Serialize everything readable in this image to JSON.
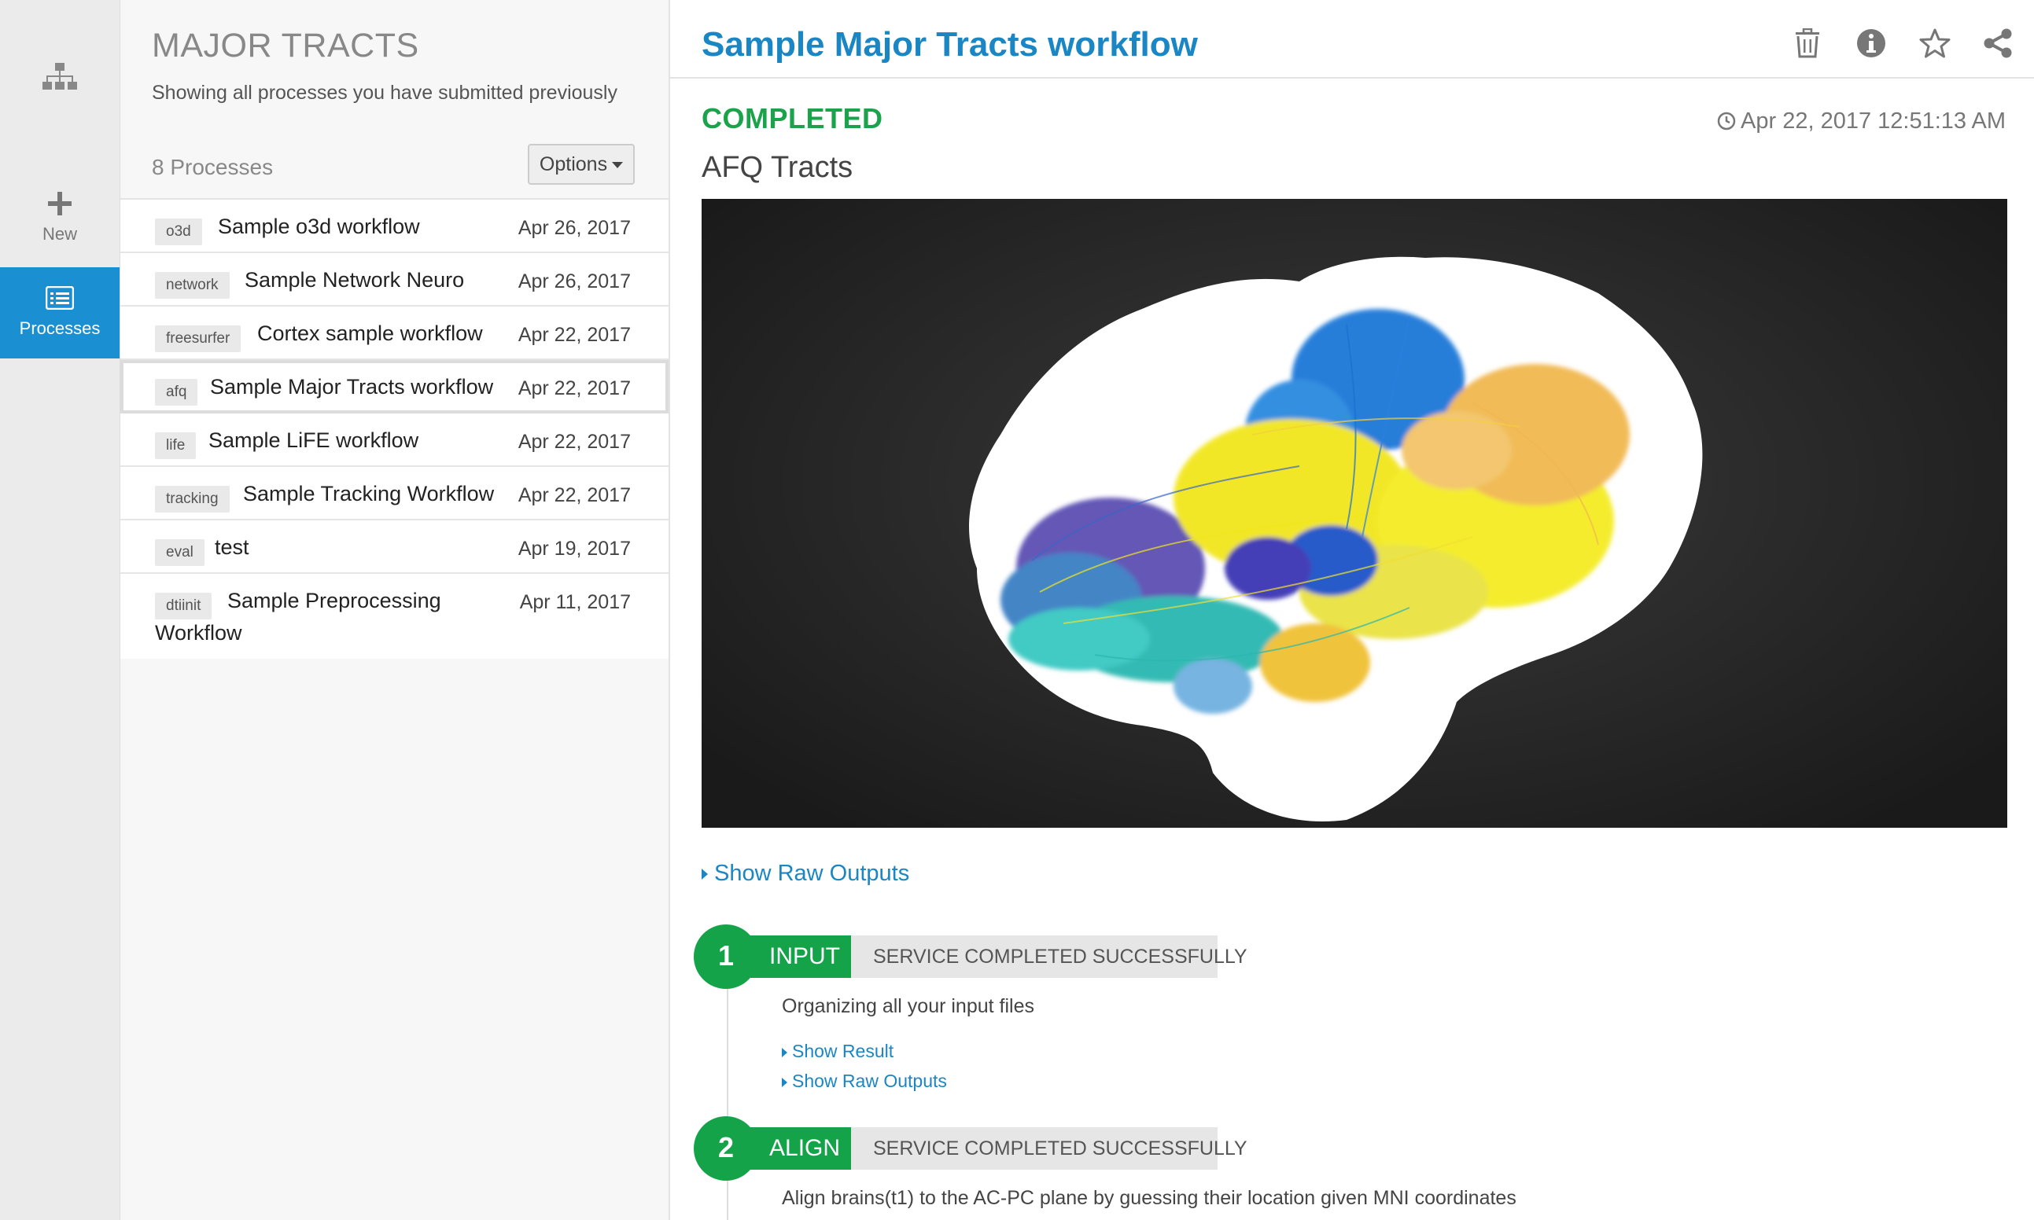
{
  "nav": {
    "new_label": "New",
    "processes_label": "Processes"
  },
  "list": {
    "title": "MAJOR TRACTS",
    "subtitle": "Showing all processes you have submitted previously",
    "count": "8 Processes",
    "options_label": "Options",
    "rows": [
      {
        "tag": "o3d",
        "name": "Sample o3d workflow",
        "date": "Apr 26, 2017"
      },
      {
        "tag": "network",
        "name": "Sample Network Neuro",
        "date": "Apr 26, 2017"
      },
      {
        "tag": "freesurfer",
        "name": "Cortex sample workflow",
        "date": "Apr 22, 2017"
      },
      {
        "tag": "afq",
        "name": "Sample Major Tracts workflow",
        "date": "Apr 22, 2017"
      },
      {
        "tag": "life",
        "name": "Sample LiFE workflow",
        "date": "Apr 22, 2017"
      },
      {
        "tag": "tracking",
        "name": "Sample Tracking Workflow",
        "date": "Apr 22, 2017"
      },
      {
        "tag": "eval",
        "name": "test",
        "date": "Apr 19, 2017"
      },
      {
        "tag": "dtiinit",
        "name": "Sample Preprocessing",
        "name2": "Workflow",
        "date": "Apr 11, 2017"
      }
    ]
  },
  "detail": {
    "title": "Sample Major Tracts workflow",
    "status": "COMPLETED",
    "timestamp": "Apr 22, 2017 12:51:13 AM",
    "app_name": "AFQ Tracts",
    "raw_outputs_label": "Show Raw Outputs",
    "steps": [
      {
        "number": "1",
        "name": "INPUT",
        "status": "SERVICE COMPLETED SUCCESSFULLY",
        "description": "Organizing all your input files",
        "show_result": "Show Result",
        "show_raw": "Show Raw Outputs"
      },
      {
        "number": "2",
        "name": "ALIGN",
        "status": "SERVICE COMPLETED SUCCESSFULLY",
        "description": "Align brains(t1) to the AC-PC plane by guessing their location given MNI coordinates"
      }
    ]
  },
  "colors": {
    "brand_blue": "#1a86c4",
    "nav_active": "#1a8fd1",
    "success_green": "#15a34a"
  },
  "icons": [
    "apps-hierarchy-icon",
    "plus-icon",
    "list-icon",
    "trash-icon",
    "info-icon",
    "star-icon",
    "share-icon",
    "clock-icon"
  ]
}
